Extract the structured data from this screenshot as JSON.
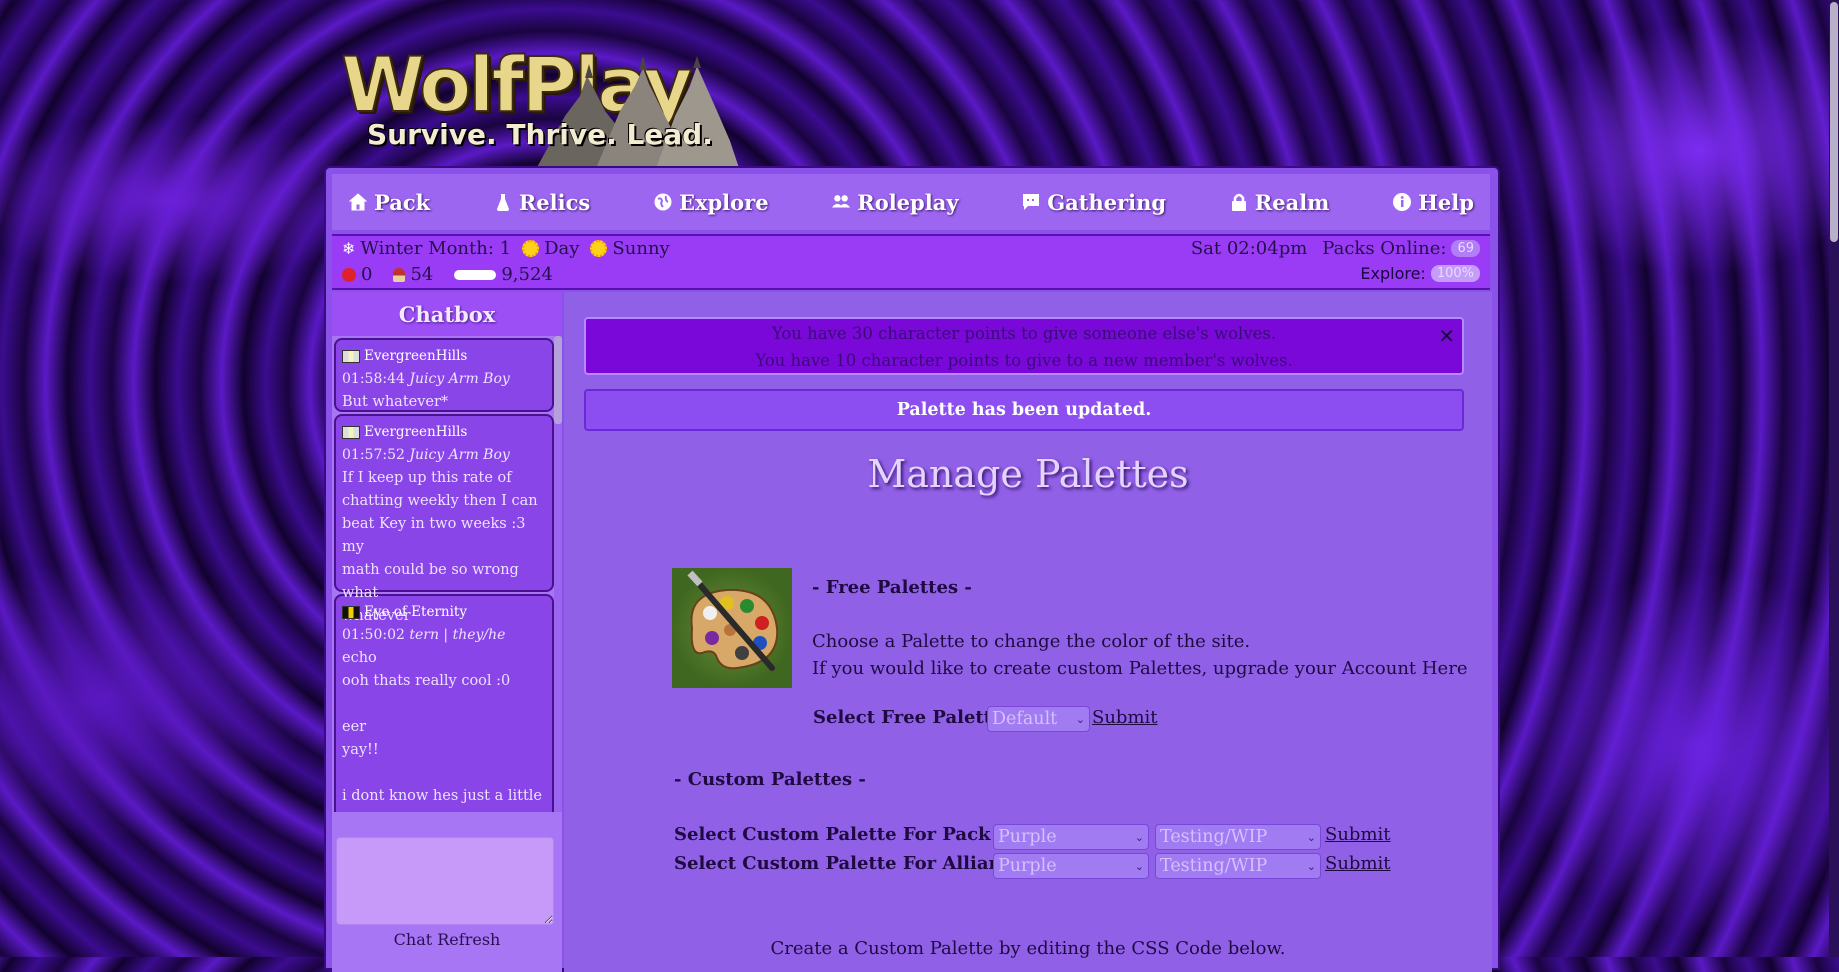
{
  "logo": {
    "word": "WolfPlay",
    "tagline": "Survive. Thrive. Lead."
  },
  "nav": [
    {
      "label": "Pack",
      "icon": "home-icon"
    },
    {
      "label": "Relics",
      "icon": "flask-icon"
    },
    {
      "label": "Explore",
      "icon": "globe-icon"
    },
    {
      "label": "Roleplay",
      "icon": "users-icon"
    },
    {
      "label": "Gathering",
      "icon": "chat-bubble-icon"
    },
    {
      "label": "Realm",
      "icon": "lock-icon"
    },
    {
      "label": "Help",
      "icon": "info-icon"
    }
  ],
  "status": {
    "season": "Winter Month: 1",
    "time_of_day": "Day",
    "weather": "Sunny",
    "clock": "Sat 02:04pm",
    "packs_online_label": "Packs Online:",
    "packs_online": "69",
    "apples": "0",
    "mushrooms": "54",
    "bones": "9,524",
    "explore_label": "Explore:",
    "explore_pct": "100%"
  },
  "chatbox": {
    "title": "Chatbox",
    "messages": [
      {
        "user": "EvergreenHills",
        "time": "01:58:44",
        "tag": "Juicy Arm Boy",
        "lines": [
          "But whatever*"
        ]
      },
      {
        "user": "EvergreenHills",
        "time": "01:57:52",
        "tag": "Juicy Arm Boy",
        "lines": [
          "If I keep up this rate of",
          "chatting weekly then I can",
          "beat Key in two weeks :3 my",
          "math could be so wrong what",
          "whatever"
        ]
      },
      {
        "user": "Eye of Eternity",
        "time": "01:50:02",
        "tag": "tern | they/he",
        "lines": [
          "echo",
          "ooh thats really cool :0",
          "",
          "eer",
          "yay!!",
          "",
          "i dont know hes just a little"
        ]
      }
    ],
    "actions": "Chat  Refresh"
  },
  "notice": {
    "line1": "You have 30 character points to give someone else's wolves.",
    "line2": "You have 10 character points to give to a new member's wolves.",
    "close": "✕"
  },
  "flash": "Palette has been updated.",
  "page_title": "Manage Palettes",
  "free": {
    "heading": "- Free Palettes -",
    "desc1": "Choose a Palette to change the color of the site.",
    "desc2": "If you would like to create custom Palettes, upgrade your Account Here",
    "select_label": "Select Free Palette",
    "select_value": "Default",
    "submit": "Submit"
  },
  "custom": {
    "heading": "- Custom Palettes -",
    "pack_label": "Select Custom Palette For Pack",
    "alliance_label": "Select Custom Palette For Alliance",
    "palette_value": "Purple",
    "status_value": "Testing/WIP",
    "submit": "Submit"
  },
  "footer_text": "Create a Custom Palette by editing the CSS Code below."
}
